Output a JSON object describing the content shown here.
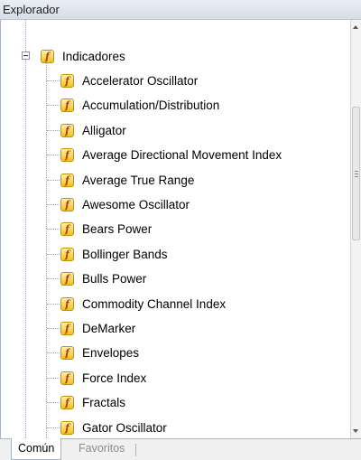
{
  "window": {
    "title": "Explorador"
  },
  "tree": {
    "root": {
      "label": "Indicadores",
      "icon": "indicator-icon",
      "expanded": true
    },
    "items": [
      {
        "label": "Accelerator Oscillator",
        "icon": "indicator-icon"
      },
      {
        "label": "Accumulation/Distribution",
        "icon": "indicator-icon"
      },
      {
        "label": "Alligator",
        "icon": "indicator-icon"
      },
      {
        "label": "Average Directional Movement Index",
        "icon": "indicator-icon"
      },
      {
        "label": "Average True Range",
        "icon": "indicator-icon"
      },
      {
        "label": "Awesome Oscillator",
        "icon": "indicator-icon"
      },
      {
        "label": "Bears Power",
        "icon": "indicator-icon"
      },
      {
        "label": "Bollinger Bands",
        "icon": "indicator-icon"
      },
      {
        "label": "Bulls Power",
        "icon": "indicator-icon"
      },
      {
        "label": "Commodity Channel Index",
        "icon": "indicator-icon"
      },
      {
        "label": "DeMarker",
        "icon": "indicator-icon"
      },
      {
        "label": "Envelopes",
        "icon": "indicator-icon"
      },
      {
        "label": "Force Index",
        "icon": "indicator-icon"
      },
      {
        "label": "Fractals",
        "icon": "indicator-icon"
      },
      {
        "label": "Gator Oscillator",
        "icon": "indicator-icon"
      }
    ]
  },
  "tabs": [
    {
      "label": "Común",
      "active": true
    },
    {
      "label": "Favoritos",
      "active": false
    }
  ],
  "colors": {
    "titlebar": "#d6dde8",
    "icon_fill": "#f3c21c",
    "icon_glyph": "#b8370d"
  }
}
